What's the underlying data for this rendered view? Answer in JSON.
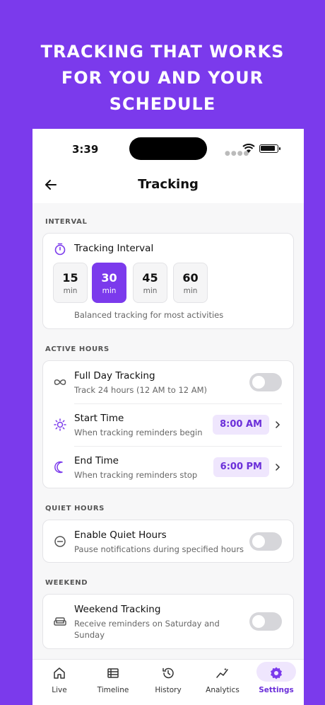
{
  "promo": {
    "line1": "Tracking that works",
    "line2": "for you and your",
    "line3": "schedule"
  },
  "status": {
    "time": "3:39"
  },
  "header": {
    "title": "Tracking"
  },
  "interval": {
    "section": "INTERVAL",
    "title": "Tracking Interval",
    "options": [
      {
        "value": "15",
        "unit": "min"
      },
      {
        "value": "30",
        "unit": "min"
      },
      {
        "value": "45",
        "unit": "min"
      },
      {
        "value": "60",
        "unit": "min"
      }
    ],
    "selected": "30",
    "description": "Balanced tracking for most activities"
  },
  "active_hours": {
    "section": "ACTIVE HOURS",
    "full_day": {
      "title": "Full Day Tracking",
      "subtitle": "Track 24 hours (12 AM to 12 AM)",
      "enabled": false
    },
    "start": {
      "title": "Start Time",
      "subtitle": "When tracking reminders begin",
      "value": "8:00 AM"
    },
    "end": {
      "title": "End Time",
      "subtitle": "When tracking reminders stop",
      "value": "6:00 PM"
    }
  },
  "quiet_hours": {
    "section": "QUIET HOURS",
    "title": "Enable Quiet Hours",
    "subtitle": "Pause notifications during specified hours",
    "enabled": false
  },
  "weekend": {
    "section": "WEEKEND",
    "title": "Weekend Tracking",
    "subtitle_line1": "Receive reminders on Saturday and",
    "subtitle_line2": "Sunday",
    "enabled": false
  },
  "tabs": [
    {
      "label": "Live",
      "icon": "home-icon"
    },
    {
      "label": "Timeline",
      "icon": "list-icon"
    },
    {
      "label": "History",
      "icon": "history-icon"
    },
    {
      "label": "Analytics",
      "icon": "analytics-icon"
    },
    {
      "label": "Settings",
      "icon": "gear-icon",
      "active": true
    }
  ],
  "colors": {
    "accent": "#7b3aec",
    "accent_light": "#efe6fd",
    "accent_text": "#6b2fd9"
  }
}
